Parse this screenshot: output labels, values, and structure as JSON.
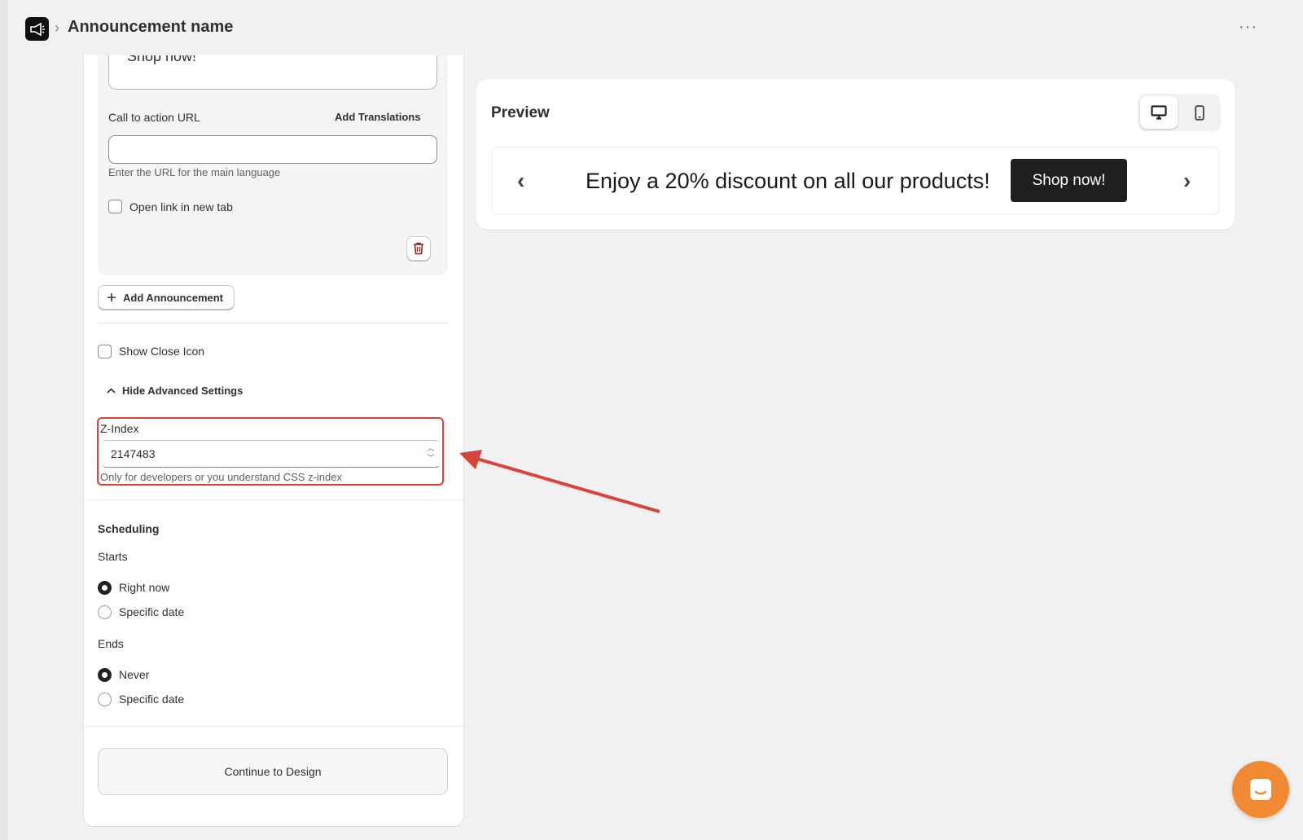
{
  "header": {
    "title": "Announcement name",
    "breadcrumb_separator": "›",
    "more_label": "···"
  },
  "announcement": {
    "text_value": "Shop now!",
    "url_label": "Call to action URL",
    "add_translations": "Add Translations",
    "url_value": "",
    "url_help": "Enter the URL for the main language",
    "new_tab_label": "Open link in new tab",
    "new_tab_checked": false
  },
  "add_announcement_label": "Add Announcement",
  "show_close_icon_label": "Show Close Icon",
  "advanced_toggle_label": "Hide Advanced Settings",
  "zindex": {
    "label": "Z-Index",
    "value": "2147483",
    "help": "Only for developers or you understand CSS z-index"
  },
  "scheduling": {
    "title": "Scheduling",
    "starts_label": "Starts",
    "starts_options": [
      "Right now",
      "Specific date"
    ],
    "starts_selected": "Right now",
    "ends_label": "Ends",
    "ends_options": [
      "Never",
      "Specific date"
    ],
    "ends_selected": "Never"
  },
  "continue_label": "Continue to Design",
  "preview": {
    "title": "Preview",
    "announcement_text": "Enjoy a 20% discount on all our products!",
    "cta_label": "Shop now!",
    "prev_arrow": "‹",
    "next_arrow": "›",
    "active_device": "desktop"
  },
  "colors": {
    "highlight": "#d9443a",
    "chat_bubble": "#f28a33",
    "cta_bg": "#1f1f1f"
  }
}
